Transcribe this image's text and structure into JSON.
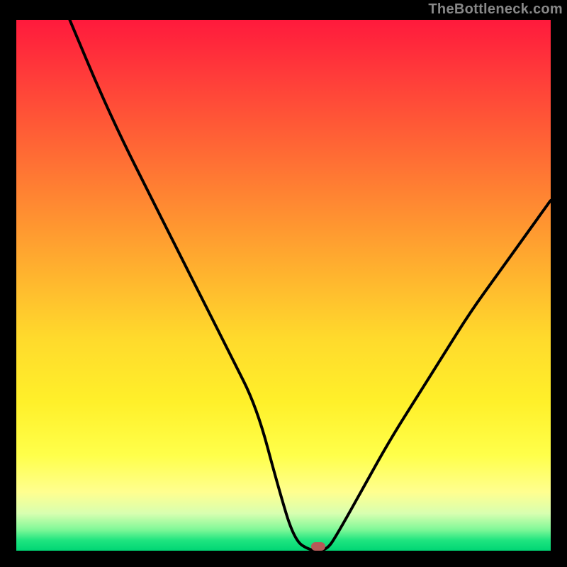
{
  "attribution": "TheBottleneck.com",
  "chart_data": {
    "type": "line",
    "title": "",
    "xlabel": "",
    "ylabel": "",
    "xlim": [
      0,
      100
    ],
    "ylim": [
      0,
      100
    ],
    "grid": false,
    "series": [
      {
        "name": "curve",
        "x": [
          10,
          15,
          20,
          25,
          30,
          35,
          40,
          45,
          49,
          52,
          55,
          58,
          60,
          65,
          70,
          75,
          80,
          85,
          90,
          95,
          100
        ],
        "y": [
          100,
          88,
          77,
          67,
          57,
          47,
          37,
          27,
          12,
          2,
          0,
          0,
          3,
          12,
          21,
          29,
          37,
          45,
          52,
          59,
          66
        ]
      }
    ],
    "marker": {
      "x": 56.5,
      "y": 0.8
    },
    "annotations": []
  },
  "colors": {
    "frame": "#000000",
    "attribution": "#888888",
    "curve": "#000000",
    "marker": "#b55a58"
  }
}
